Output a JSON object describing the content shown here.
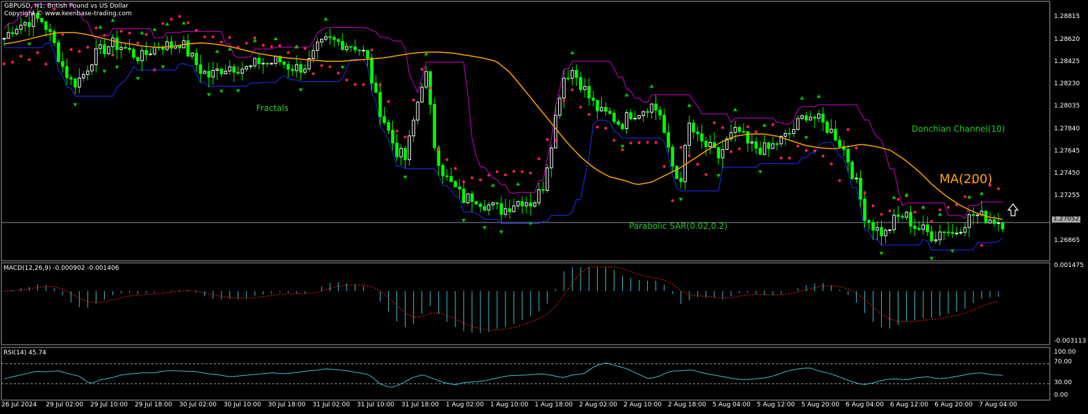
{
  "header": {
    "symbol_line": "GBPUSD, H1:  British Pound vs US Dollar",
    "copyright": "Copyright © www.keenbase-trading.com"
  },
  "annotations": {
    "fractals": "Fractals",
    "donchian": "Donchian Channel(10)",
    "ma": "MA(200)",
    "sar": "Parabolic SAR(0.02,0.2)"
  },
  "current_price": "1.27052",
  "macd_label": "MACD(12,26,9) -0.000902 -0.001406",
  "rsi_label": "RSI(14) 45.74",
  "colors": {
    "background": "#000000",
    "candle_up": "#ffffff",
    "candle_down": "#00ff00",
    "ma": "#ffa500",
    "donchian_upper": "#d000d0",
    "donchian_lower": "#2030ff",
    "sar": "#ff2050",
    "fractal": "#00cc00",
    "macd_hist": "#40c0d0",
    "macd_signal": "#ff2020",
    "rsi": "#40c0d0",
    "axis": "#ffffff"
  },
  "chart_data": [
    {
      "type": "candlestick",
      "title": "GBPUSD, H1:  British Pound vs US Dollar",
      "y_ticks": [
        "1.28815",
        "1.28620",
        "1.28425",
        "1.28230",
        "1.28035",
        "1.27840",
        "1.27645",
        "1.27450",
        "1.27255",
        "1.26865"
      ],
      "ylim": [
        1.2672,
        1.2897
      ],
      "x_ticks": [
        "26 Jul 2024",
        "29 Jul 02:00",
        "29 Jul 10:00",
        "29 Jul 18:00",
        "30 Jul 02:00",
        "30 Jul 10:00",
        "30 Jul 18:00",
        "31 Jul 02:00",
        "31 Jul 10:00",
        "31 Jul 18:00",
        "1 Aug 02:00",
        "1 Aug 10:00",
        "1 Aug 18:00",
        "2 Aug 02:00",
        "2 Aug 10:00",
        "2 Aug 18:00",
        "5 Aug 04:00",
        "5 Aug 12:00",
        "5 Aug 20:00",
        "6 Aug 04:00",
        "6 Aug 12:00",
        "6 Aug 20:00",
        "7 Aug 04:00"
      ],
      "close_path": [
        1.2865,
        1.2875,
        1.2878,
        1.2882,
        1.288,
        1.2862,
        1.284,
        1.2825,
        1.2832,
        1.2848,
        1.2855,
        1.286,
        1.2858,
        1.2852,
        1.2848,
        1.2855,
        1.286,
        1.2858,
        1.2862,
        1.285,
        1.2838,
        1.2832,
        1.2838,
        1.2841,
        1.284,
        1.2838,
        1.2845,
        1.2843,
        1.2846,
        1.2841,
        1.2839,
        1.2842,
        1.2856,
        1.2863,
        1.2862,
        1.286,
        1.2858,
        1.285,
        1.2812,
        1.279,
        1.2768,
        1.276,
        1.28,
        1.284,
        1.277,
        1.2745,
        1.2735,
        1.2725,
        1.2728,
        1.2722,
        1.2718,
        1.2716,
        1.2722,
        1.2725,
        1.2722,
        1.2735,
        1.278,
        1.283,
        1.2838,
        1.2825,
        1.281,
        1.28,
        1.2798,
        1.279,
        1.28,
        1.2802,
        1.2808,
        1.28,
        1.276,
        1.2738,
        1.279,
        1.2775,
        1.277,
        1.2762,
        1.2778,
        1.2785,
        1.2772,
        1.277,
        1.2768,
        1.2775,
        1.278,
        1.279,
        1.28,
        1.2795,
        1.2788,
        1.278,
        1.2765,
        1.274,
        1.271,
        1.27,
        1.2695,
        1.2708,
        1.2712,
        1.2702,
        1.2698,
        1.2693,
        1.27,
        1.2695,
        1.2705,
        1.2712,
        1.271,
        1.2708,
        1.27052
      ],
      "series": [
        {
          "name": "MA(200)",
          "values": [
            1.286,
            1.2862,
            1.2865,
            1.2868,
            1.287,
            1.287,
            1.2868,
            1.2865,
            1.2862,
            1.286,
            1.2858,
            1.2857,
            1.2858,
            1.286,
            1.2861,
            1.286,
            1.2858,
            1.2855,
            1.2852,
            1.285,
            1.2848,
            1.2847,
            1.2846,
            1.2845,
            1.2845,
            1.2846,
            1.2847,
            1.2848,
            1.285,
            1.2852,
            1.2853,
            1.2853,
            1.2852,
            1.285,
            1.2848,
            1.2845,
            1.2835,
            1.282,
            1.2805,
            1.279,
            1.2775,
            1.2762,
            1.2752,
            1.2745,
            1.2742,
            1.2738,
            1.274,
            1.2746,
            1.2752,
            1.276,
            1.2768,
            1.2775,
            1.278,
            1.2782,
            1.2782,
            1.278,
            1.2776,
            1.2772,
            1.277,
            1.2769,
            1.2771,
            1.2773,
            1.2771,
            1.2768,
            1.276,
            1.275,
            1.2738,
            1.2728,
            1.272,
            1.2714,
            1.271,
            1.2708
          ]
        }
      ]
    },
    {
      "type": "bar",
      "title": "MACD(12,26,9) -0.000902 -0.001406",
      "y_ticks": [
        "0.001475",
        "-0.003113"
      ],
      "ylim": [
        -0.003113,
        0.001475
      ]
    },
    {
      "type": "line",
      "title": "RSI(14) 45.74",
      "y_ticks": [
        "100.00",
        "70.00",
        "30.00",
        "0.00"
      ],
      "ylim": [
        0,
        100
      ],
      "values": [
        40,
        45,
        50,
        55,
        54,
        56,
        50,
        45,
        30,
        38,
        42,
        48,
        50,
        52,
        52,
        56,
        56,
        55,
        54,
        50,
        48,
        44,
        46,
        48,
        50,
        52,
        50,
        52,
        55,
        57,
        60,
        58,
        56,
        52,
        48,
        30,
        22,
        30,
        42,
        48,
        40,
        32,
        28,
        33,
        34,
        37,
        42,
        46,
        47,
        48,
        50,
        47,
        42,
        48,
        50,
        65,
        72,
        66,
        60,
        50,
        40,
        45,
        55,
        56,
        58,
        52,
        48,
        44,
        40,
        38,
        40,
        42,
        48,
        56,
        60,
        62,
        55,
        50,
        42,
        34,
        28,
        32,
        38,
        40,
        38,
        42,
        44,
        40,
        42,
        46,
        50,
        52,
        48,
        47
      ]
    }
  ]
}
